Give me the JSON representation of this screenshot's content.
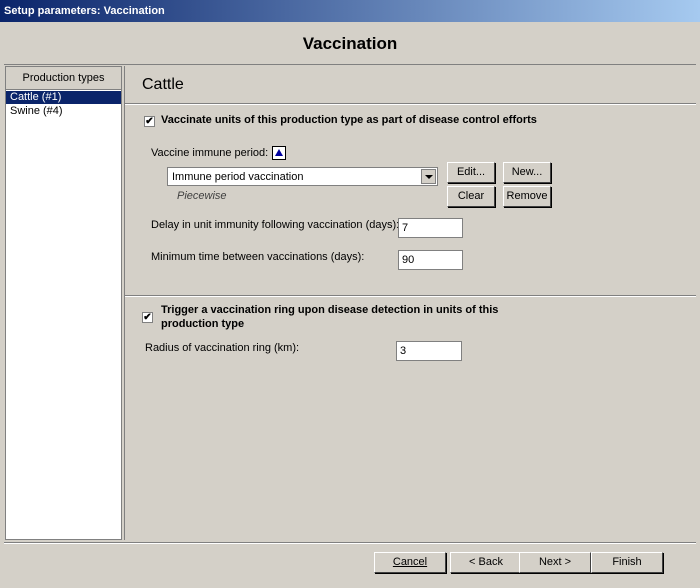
{
  "window": {
    "title": "Setup parameters: Vaccination"
  },
  "header": {
    "title": "Vaccination"
  },
  "sidebar": {
    "header": "Production types",
    "items": [
      {
        "label": "Cattle (#1)",
        "selected": true
      },
      {
        "label": "Swine (#4)",
        "selected": false
      }
    ]
  },
  "main": {
    "section_title": "Cattle",
    "vaccinate": {
      "checked": true,
      "label": "Vaccinate units of this production type as part of disease control efforts"
    },
    "immune_period": {
      "label": "Vaccine immune period:",
      "select_value": "Immune period vaccination",
      "subtext": "Piecewise",
      "edit_label": "Edit...",
      "new_label": "New...",
      "clear_label": "Clear",
      "remove_label": "Remove"
    },
    "delay": {
      "label": "Delay in unit immunity following vaccination (days):",
      "value": "7"
    },
    "min_time": {
      "label": "Minimum time between vaccinations (days):",
      "value": "90"
    },
    "trigger": {
      "checked": true,
      "label_line1": "Trigger a vaccination ring upon disease detection in units of this",
      "label_line2": "production type"
    },
    "radius": {
      "label": "Radius of vaccination ring (km):",
      "value": "3"
    }
  },
  "footer": {
    "cancel_label": "Cancel",
    "back_label": "< Back",
    "next_label": "Next >",
    "finish_label": "Finish"
  }
}
